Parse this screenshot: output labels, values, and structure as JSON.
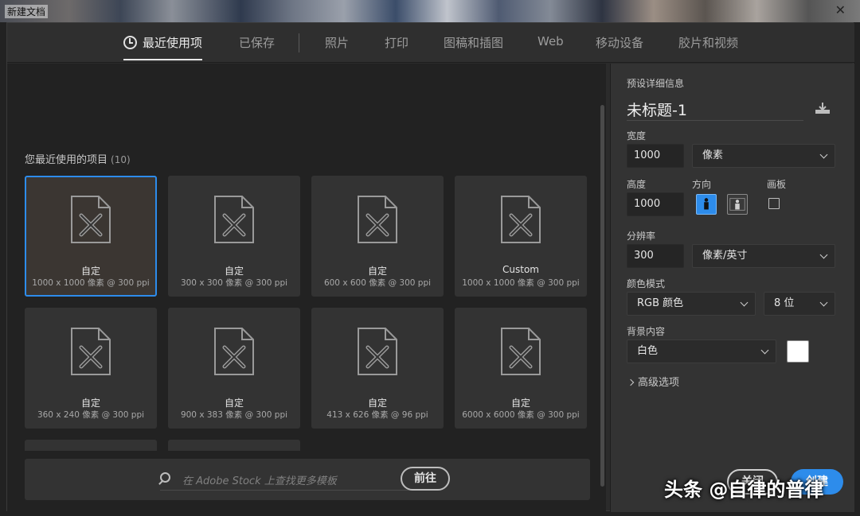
{
  "window": {
    "title": "新建文档",
    "close_glyph": "✕"
  },
  "tabs": [
    {
      "label": "最近使用项",
      "active": true
    },
    {
      "label": "已保存"
    },
    {
      "label": "照片"
    },
    {
      "label": "打印"
    },
    {
      "label": "图稿和插图"
    },
    {
      "label": "Web"
    },
    {
      "label": "移动设备"
    },
    {
      "label": "胶片和视频"
    }
  ],
  "recent": {
    "title": "您最近使用的项目",
    "count": "(10)",
    "items": [
      {
        "name": "自定",
        "desc": "1000 x 1000 像素 @ 300 ppi",
        "selected": true
      },
      {
        "name": "自定",
        "desc": "300 x 300 像素 @ 300 ppi"
      },
      {
        "name": "自定",
        "desc": "600 x 600 像素 @ 300 ppi"
      },
      {
        "name": "Custom",
        "desc": "1000 x 1000 像素 @ 300 ppi"
      },
      {
        "name": "自定",
        "desc": "360 x 240 像素 @ 300 ppi"
      },
      {
        "name": "自定",
        "desc": "900 x 383 像素 @ 300 ppi"
      },
      {
        "name": "自定",
        "desc": "413 x 626 像素 @ 96 ppi"
      },
      {
        "name": "自定",
        "desc": "6000 x 6000 像素 @ 300 ppi"
      }
    ]
  },
  "stock": {
    "placeholder": "在 Adobe Stock 上查找更多模板",
    "go_label": "前往"
  },
  "preset": {
    "section_title": "预设详细信息",
    "name": "未标题-1",
    "width_label": "宽度",
    "width_value": "1000",
    "width_unit": "像素",
    "height_label": "高度",
    "height_value": "1000",
    "orientation_label": "方向",
    "artboard_label": "画板",
    "resolution_label": "分辨率",
    "resolution_value": "300",
    "resolution_unit": "像素/英寸",
    "color_mode_label": "颜色模式",
    "color_mode": "RGB 颜色",
    "bit_depth": "8 位",
    "background_label": "背景内容",
    "background": "白色",
    "background_color": "#ffffff",
    "advanced_label": "高级选项"
  },
  "actions": {
    "close_label": "关闭",
    "create_label": "创建"
  },
  "watermark": "头条 @自律的普律",
  "colors": {
    "accent": "#2d8ceb",
    "panel": "#333333",
    "content": "#222222"
  }
}
